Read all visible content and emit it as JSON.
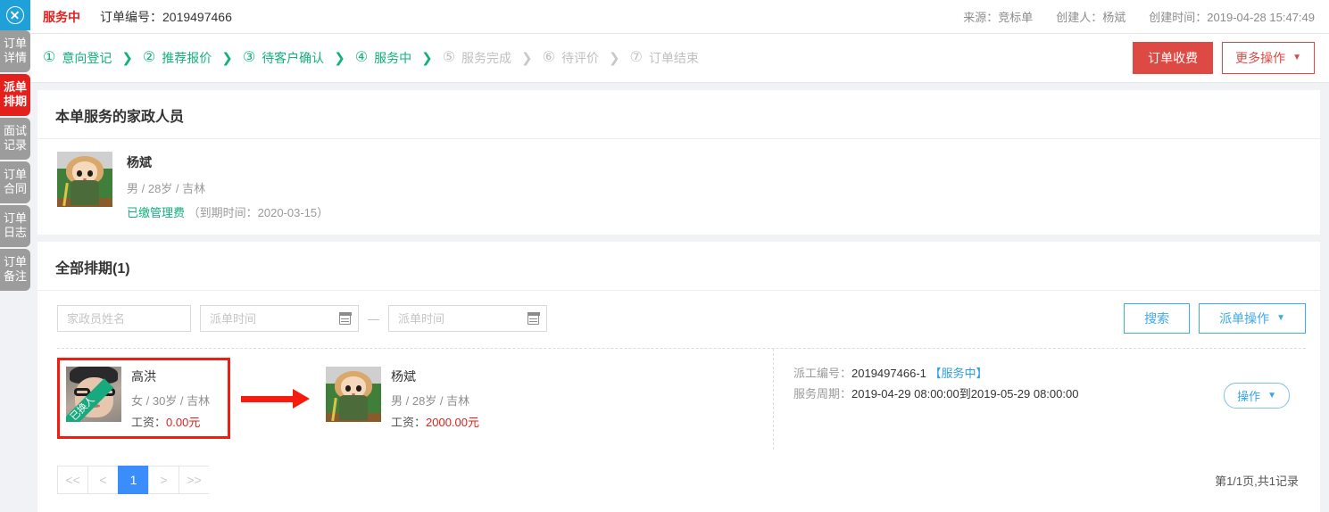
{
  "rail": {
    "close_icon": "close-circle-icon",
    "tabs": [
      {
        "label": "订单详情",
        "active": false
      },
      {
        "label": "派单排期",
        "active": true
      },
      {
        "label": "面试记录",
        "active": false
      },
      {
        "label": "订单合同",
        "active": false
      },
      {
        "label": "订单日志",
        "active": false
      },
      {
        "label": "订单备注",
        "active": false
      }
    ]
  },
  "header": {
    "status": "服务中",
    "order_no_label": "订单编号：",
    "order_no": "2019497466",
    "source": "来源：竞标单",
    "creator": "创建人：杨斌",
    "created_at": "创建时间：2019-04-28 15:47:49"
  },
  "steps": {
    "items": [
      {
        "num": "①",
        "label": "意向登记",
        "state": "done"
      },
      {
        "num": "②",
        "label": "推荐报价",
        "state": "done"
      },
      {
        "num": "③",
        "label": "待客户确认",
        "state": "done"
      },
      {
        "num": "④",
        "label": "服务中",
        "state": "done"
      },
      {
        "num": "⑤",
        "label": "服务完成",
        "state": "todo"
      },
      {
        "num": "⑥",
        "label": "待评价",
        "state": "todo"
      },
      {
        "num": "⑦",
        "label": "订单结束",
        "state": "todo"
      }
    ],
    "fee_button": "订单收费",
    "more_button": "更多操作"
  },
  "staff_panel": {
    "title": "本单服务的家政人员",
    "name": "杨斌",
    "sub": "男 / 28岁 / 吉林",
    "fee_status": "已缴管理费",
    "fee_expire": "（到期时间：2020-03-15）"
  },
  "schedule_panel": {
    "title": "全部排期(1)",
    "filters": {
      "name_placeholder": "家政员姓名",
      "date_from_placeholder": "派单时间",
      "date_to_placeholder": "派单时间",
      "name_value": "",
      "date_from_value": "",
      "date_to_value": "",
      "separator": "—"
    },
    "search_button": "搜索",
    "dispatch_button": "派单操作",
    "row": {
      "replaced_worker": {
        "name": "高洪",
        "sub": "女 / 30岁 / 吉林",
        "salary_label": "工资：",
        "salary": "0.00元",
        "ribbon": "已换人"
      },
      "current_worker": {
        "name": "杨斌",
        "sub": "男 / 28岁 / 吉林",
        "salary_label": "工资：",
        "salary": "2000.00元"
      },
      "dispatch_no_label": "派工编号：",
      "dispatch_no": "2019497466-1",
      "dispatch_status": "【服务中】",
      "period_label": "服务周期：",
      "period": "2019-04-29 08:00:00到2019-05-29 08:00:00",
      "op_button": "操作"
    },
    "pager": {
      "first": "<<",
      "prev": "<",
      "current": "1",
      "next": ">",
      "last": ">>",
      "info": "第1/1页,共1记录"
    }
  },
  "colors": {
    "accent_blue": "#20a0d8",
    "danger_red": "#e4201c",
    "success_green": "#12b07c",
    "link_blue": "#40a9e8",
    "highlight_red": "#f51b0f"
  }
}
